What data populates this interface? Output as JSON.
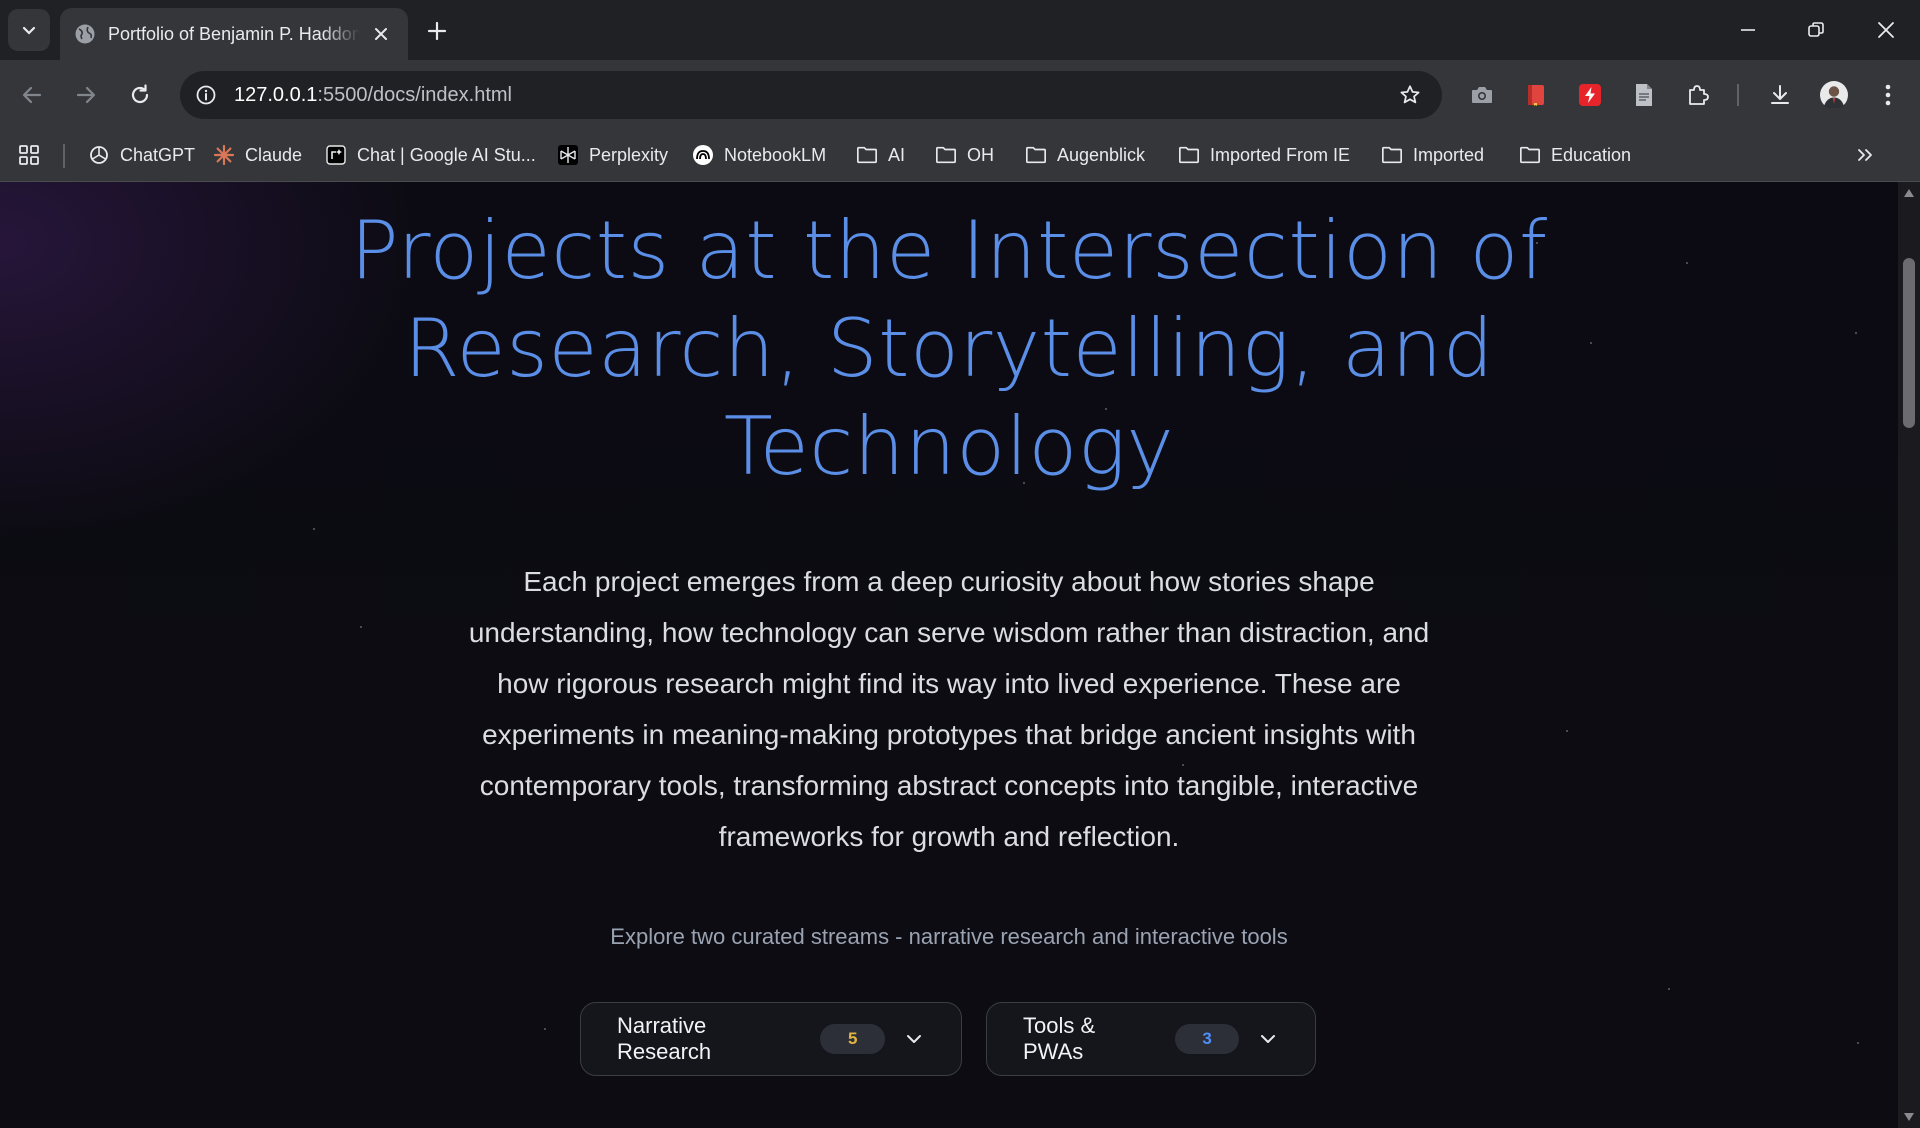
{
  "browser": {
    "tab": {
      "title": "Portfolio of Benjamin P. Haddon"
    },
    "address": {
      "host": "127.0.0.1",
      "path": ":5500/docs/index.html"
    },
    "bookmarks": [
      {
        "label": "ChatGPT",
        "icon": "chatgpt-icon"
      },
      {
        "label": "Claude",
        "icon": "claude-icon"
      },
      {
        "label": "Chat | Google AI Stu...",
        "icon": "google-ai-studio-icon"
      },
      {
        "label": "Perplexity",
        "icon": "perplexity-icon"
      },
      {
        "label": "NotebookLM",
        "icon": "notebooklm-icon"
      },
      {
        "label": "AI",
        "icon": "folder-icon"
      },
      {
        "label": "OH",
        "icon": "folder-icon"
      },
      {
        "label": "Augenblick",
        "icon": "folder-icon"
      },
      {
        "label": "Imported From IE",
        "icon": "folder-icon"
      },
      {
        "label": "Imported",
        "icon": "folder-icon"
      },
      {
        "label": "Education",
        "icon": "folder-icon"
      }
    ]
  },
  "page": {
    "title_lines": [
      "Projects at the Intersection of",
      "Research, Storytelling, and",
      "Technology"
    ],
    "intro": "Each project emerges from a deep curiosity about how stories shape understanding, how technology can serve wisdom rather than distraction, and how rigorous research might find its way into lived experience. These are experiments in meaning-making prototypes that bridge ancient insights with contemporary tools, transforming abstract concepts into tangible, interactive frameworks for growth and reflection.",
    "subtitle": "Explore two curated streams - narrative research and interactive tools",
    "streams": [
      {
        "label": "Narrative Research",
        "count": "5",
        "badge_color": "#e3b341"
      },
      {
        "label": "Tools & PWAs",
        "count": "3",
        "badge_color": "#4f8ef7"
      }
    ]
  },
  "colors": {
    "accent": "#5b8ee6",
    "background": "#0c0b13"
  }
}
